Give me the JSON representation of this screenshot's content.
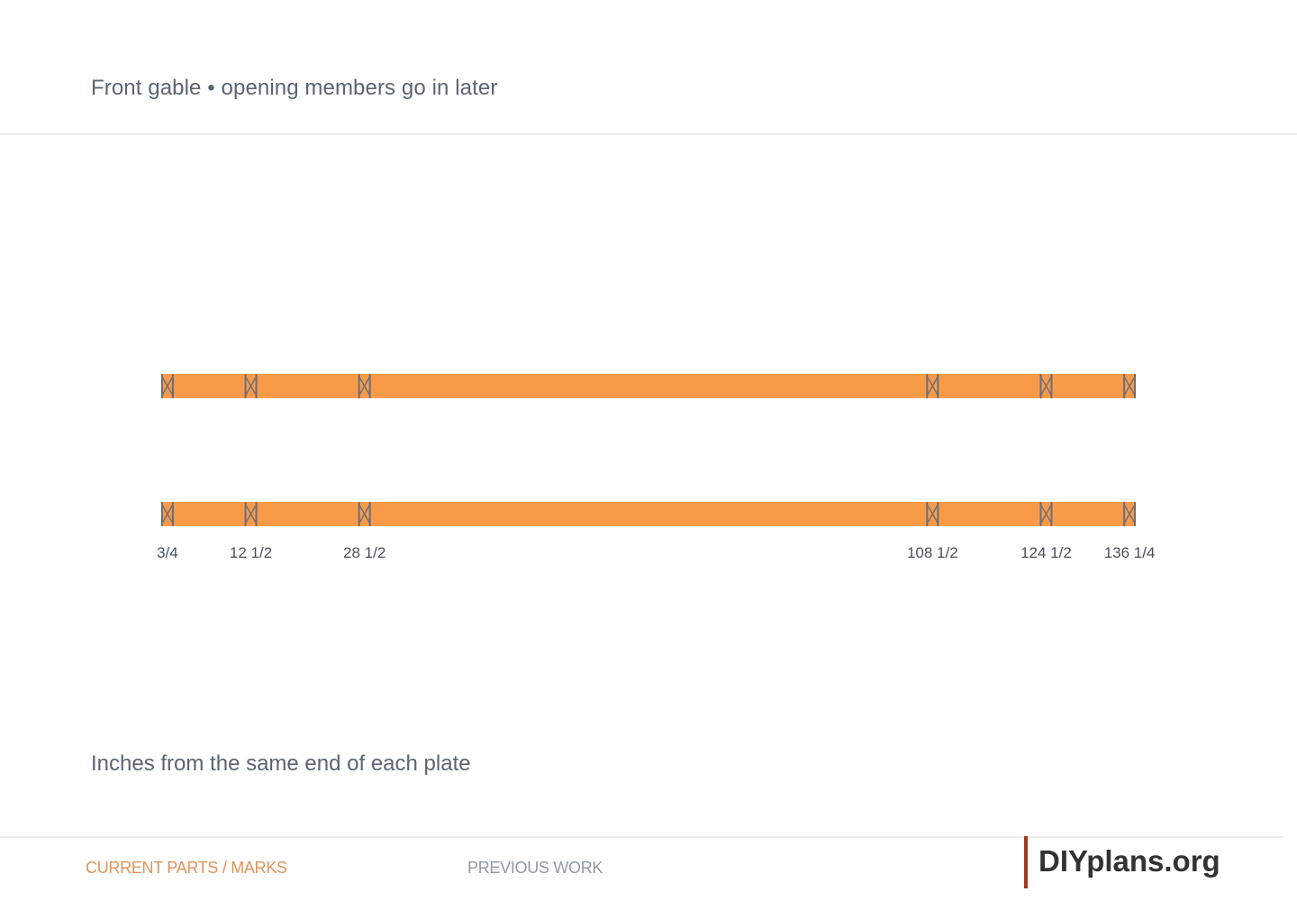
{
  "header": {
    "title": "Front gable • opening members go in later"
  },
  "diagram": {
    "plate_color": "#f99a49",
    "mark_color": "#6a6e78",
    "plate_length": 137,
    "plates": [
      {
        "id": "top-plate"
      },
      {
        "id": "bottom-plate"
      }
    ],
    "marks": [
      {
        "value": 0.75,
        "label": "3/4"
      },
      {
        "value": 12.5,
        "label": "12 1/2"
      },
      {
        "value": 28.5,
        "label": "28 1/2"
      },
      {
        "value": 108.5,
        "label": "108 1/2"
      },
      {
        "value": 124.5,
        "label": "124 1/2"
      },
      {
        "value": 136.25,
        "label": "136 1/4"
      }
    ]
  },
  "note": "Inches from the same end of each plate",
  "footer": {
    "nav": {
      "current_label": "CURRENT PARTS / MARKS",
      "previous_label": "PREVIOUS WORK"
    },
    "brand": {
      "name": "DIYplans.org",
      "accent_color": "#a0391f"
    }
  }
}
